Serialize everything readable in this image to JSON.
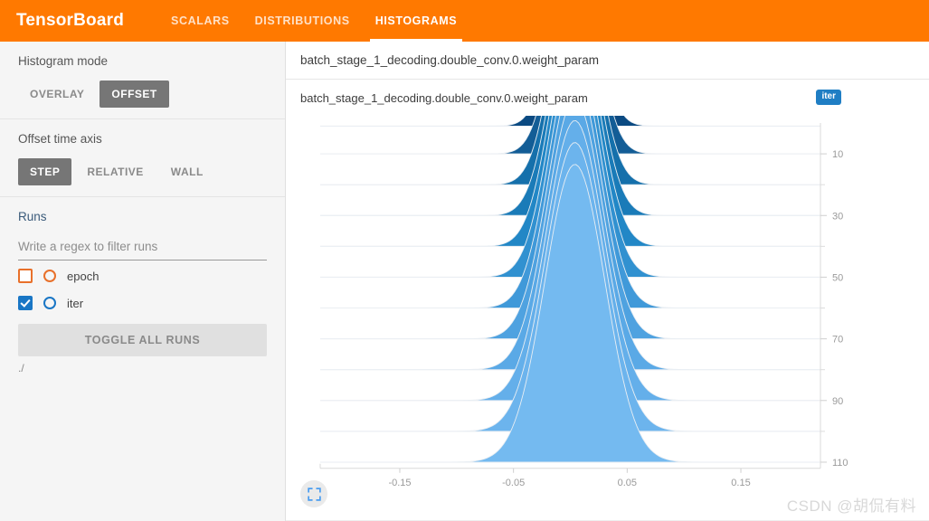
{
  "topbar": {
    "brand": "TensorBoard",
    "tabs": [
      {
        "label": "SCALARS",
        "active": false
      },
      {
        "label": "DISTRIBUTIONS",
        "active": false
      },
      {
        "label": "HISTOGRAMS",
        "active": true
      }
    ],
    "background": "#ff7900"
  },
  "sidebar": {
    "histogram_mode": {
      "title": "Histogram mode",
      "options": [
        "OVERLAY",
        "OFFSET"
      ],
      "selected": "OFFSET"
    },
    "offset_time_axis": {
      "title": "Offset time axis",
      "options": [
        "STEP",
        "RELATIVE",
        "WALL"
      ],
      "selected": "STEP"
    },
    "runs": {
      "title": "Runs",
      "filter_placeholder": "Write a regex to filter runs",
      "filter_value": "",
      "items": [
        {
          "label": "epoch",
          "checked": false,
          "color": "#e8702a"
        },
        {
          "label": "iter",
          "checked": true,
          "color": "#1976c5"
        }
      ],
      "toggle_all_label": "TOGGLE ALL RUNS",
      "path": "./"
    }
  },
  "main": {
    "tag_header": "batch_stage_1_decoding.double_conv.0.weight_param",
    "card": {
      "title": "batch_stage_1_decoding.double_conv.0.weight_param",
      "run_chip": "iter",
      "expand_icon": "fullscreen-icon"
    }
  },
  "watermark": "CSDN @胡侃有料",
  "chart_data": {
    "type": "area",
    "subtype": "ridgeline-histogram-offset",
    "title": "batch_stage_1_decoding.double_conv.0.weight_param",
    "xlabel": "",
    "ylabel": "",
    "xlim": [
      -0.22,
      0.22
    ],
    "xticks": [
      -0.15,
      -0.05,
      0.05,
      0.15
    ],
    "xtick_labels": [
      "-0.15",
      "-0.05",
      "0.05",
      "0.15"
    ],
    "ylim": [
      0,
      115
    ],
    "yticks": [
      10,
      30,
      50,
      70,
      90,
      110
    ],
    "ytick_labels": [
      "10",
      "30",
      "50",
      "70",
      "90",
      "110"
    ],
    "y_minor_ticks": [
      20,
      40,
      60,
      80,
      100
    ],
    "y_axis_position": "right",
    "grid": true,
    "legend": "iter",
    "colormap": [
      "#0b4a82",
      "#135d96",
      "#1570ab",
      "#1a7bb8",
      "#2287c6",
      "#3191d0",
      "#4099d9",
      "#4fa2e0",
      "#5aa9e6",
      "#64afea",
      "#6cb4ed",
      "#74baf0"
    ],
    "steps": [
      110,
      100,
      90,
      80,
      70,
      60,
      50,
      40,
      30,
      20,
      10,
      1
    ],
    "series": [
      {
        "name": "step 110",
        "mean": 0.004,
        "sigma": 0.0265,
        "amplitude": 1.0,
        "color": "#74baf0",
        "baseline": 110
      },
      {
        "name": "step 100",
        "mean": 0.004,
        "sigma": 0.0258,
        "amplitude": 0.97,
        "color": "#6cb4ed",
        "baseline": 100
      },
      {
        "name": "step 90",
        "mean": 0.004,
        "sigma": 0.025,
        "amplitude": 0.94,
        "color": "#64afea",
        "baseline": 90
      },
      {
        "name": "step 80",
        "mean": 0.004,
        "sigma": 0.0242,
        "amplitude": 0.91,
        "color": "#5aa9e6",
        "baseline": 80
      },
      {
        "name": "step 70",
        "mean": 0.004,
        "sigma": 0.0234,
        "amplitude": 0.88,
        "color": "#4fa2e0",
        "baseline": 70
      },
      {
        "name": "step 60",
        "mean": 0.004,
        "sigma": 0.0226,
        "amplitude": 0.85,
        "color": "#4099d9",
        "baseline": 60
      },
      {
        "name": "step 50",
        "mean": 0.004,
        "sigma": 0.0218,
        "amplitude": 0.82,
        "color": "#3191d0",
        "baseline": 50
      },
      {
        "name": "step 40",
        "mean": 0.004,
        "sigma": 0.021,
        "amplitude": 0.79,
        "color": "#2287c6",
        "baseline": 40
      },
      {
        "name": "step 30",
        "mean": 0.004,
        "sigma": 0.0202,
        "amplitude": 0.76,
        "color": "#1a7bb8",
        "baseline": 30
      },
      {
        "name": "step 20",
        "mean": 0.004,
        "sigma": 0.0194,
        "amplitude": 0.73,
        "color": "#1570ab",
        "baseline": 20
      },
      {
        "name": "step 10",
        "mean": 0.004,
        "sigma": 0.0186,
        "amplitude": 0.7,
        "color": "#135d96",
        "baseline": 10
      },
      {
        "name": "step 1",
        "mean": 0.004,
        "sigma": 0.0178,
        "amplitude": 0.68,
        "color": "#0b4a82",
        "baseline": 1
      }
    ]
  }
}
